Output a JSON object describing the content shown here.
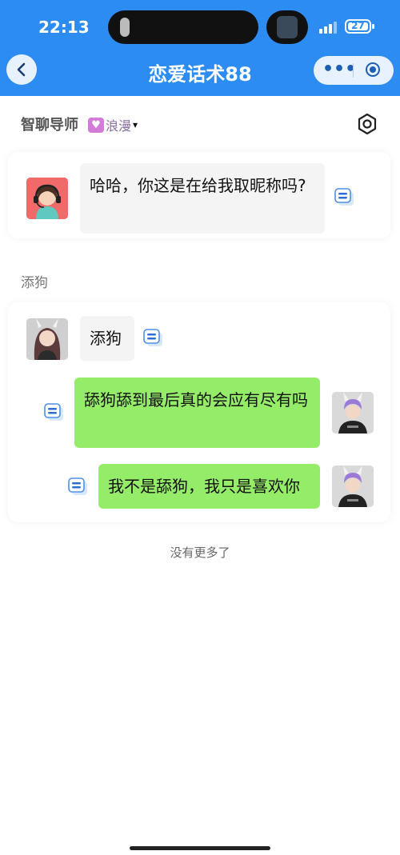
{
  "status_bar": {
    "time": "22:13",
    "battery": "27"
  },
  "header": {
    "title": "恋爱话术88"
  },
  "mentor": {
    "title": "智聊导师",
    "mode_icon": "heart-icon",
    "mode_label": "浪漫",
    "mode_caret": "▾"
  },
  "card_mentor": {
    "message": "哈哈，你这是在给我取昵称吗?"
  },
  "conversation": {
    "label": "添狗",
    "messages": [
      {
        "side": "left",
        "text": "添狗"
      },
      {
        "side": "right",
        "text": "舔狗舔到最后真的会应有尽有吗"
      },
      {
        "side": "right",
        "text": "我不是舔狗，我只是喜欢你"
      }
    ]
  },
  "footer": {
    "no_more": "没有更多了"
  },
  "colors": {
    "header_blue": "#2c8cf2",
    "bubble_green": "#95ec69",
    "bubble_gray": "#f4f4f4"
  }
}
